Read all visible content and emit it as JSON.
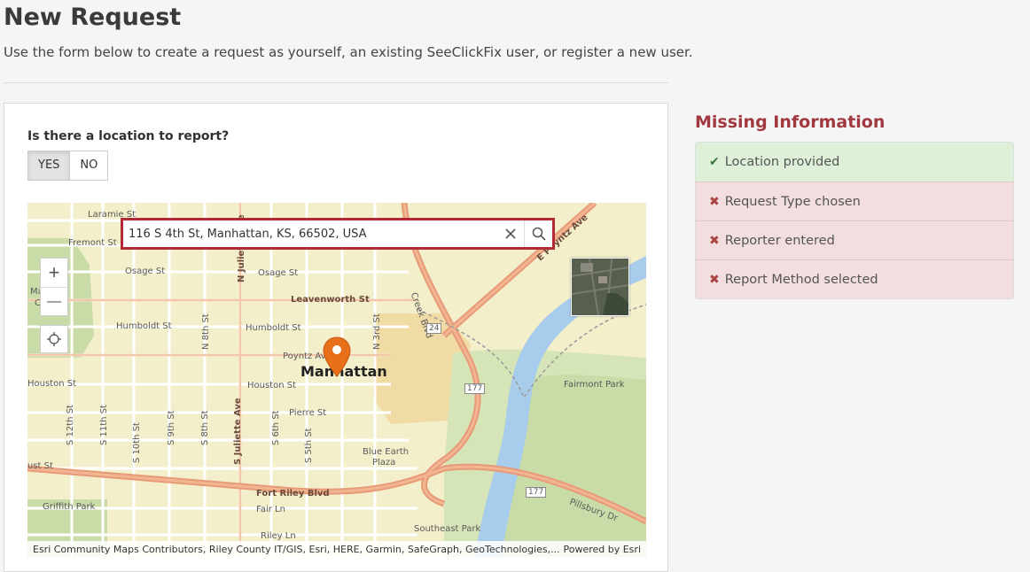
{
  "header": {
    "title": "New Request",
    "subtitle": "Use the form below to create a request as yourself, an existing SeeClickFix user, or register a new user."
  },
  "location": {
    "question": "Is there a location to report?",
    "yes_label": "YES",
    "no_label": "NO",
    "selected": "YES"
  },
  "map": {
    "search_value": "116 S 4th St, Manhattan, KS, 66502, USA",
    "zoom_in": "+",
    "zoom_out": "—",
    "attribution": "Esri Community Maps Contributors, Riley County IT/GIS, Esri, HERE, Garmin, SafeGraph, GeoTechnologies,...",
    "powered_by": "Powered by Esri",
    "city_label": "Manhattan",
    "labels": {
      "laramie": "Laramie St",
      "fremont": "Fremont St",
      "osage1": "Osage St",
      "osage2": "Osage St",
      "leavenworth": "Leavenworth St",
      "humboldt1": "Humboldt St",
      "humboldt2": "Humboldt St",
      "poyntz": "Poyntz Ave",
      "houston1": "Houston St",
      "houston2": "Houston St",
      "pierre": "Pierre St",
      "fortriley": "Fort Riley Blvd",
      "fair": "Fair Ln",
      "riley": "Riley Ln",
      "griffith": "Griffith Park",
      "southeast": "Southeast Park",
      "fairmont": "Fairmont Park",
      "blueearth": "Blue Earth",
      "plaza": "Plaza",
      "pillsbury": "Pillsbury Dr",
      "eponytz": "E Poyntz Ave",
      "njuliette": "N Juliette Ave",
      "sjuliette": "S Juliette Ave",
      "n8th": "N 8th St",
      "n3rd": "N 3rd St",
      "s12th": "S 12th St",
      "s11th": "S 11th St",
      "s10th": "S 10th St",
      "s9th": "S 9th St",
      "s8th": "S 8th St",
      "s6th": "S 6th St",
      "s5th": "S 5th St",
      "creek": "Creek Blvd",
      "hwy24": "24",
      "hwy177a": "177",
      "hwy177b": "177",
      "mc": "Ma",
      "mc2": "C",
      "st": "ust St"
    }
  },
  "missing": {
    "title": "Missing Information",
    "items": [
      {
        "label": "Location provided",
        "status": "ok"
      },
      {
        "label": "Request Type chosen",
        "status": "missing"
      },
      {
        "label": "Reporter entered",
        "status": "missing"
      },
      {
        "label": "Report Method selected",
        "status": "missing"
      }
    ]
  },
  "colors": {
    "accent_red": "#a2383f",
    "search_border": "#b22a35",
    "pin": "#e8701a",
    "ok_bg": "#dff0d8",
    "missing_bg": "#f2dede"
  },
  "icons": {
    "check": "check-icon",
    "cross": "cross-icon",
    "search": "search-icon",
    "clear": "close-icon",
    "locate": "locate-icon",
    "pin": "map-pin-icon"
  }
}
